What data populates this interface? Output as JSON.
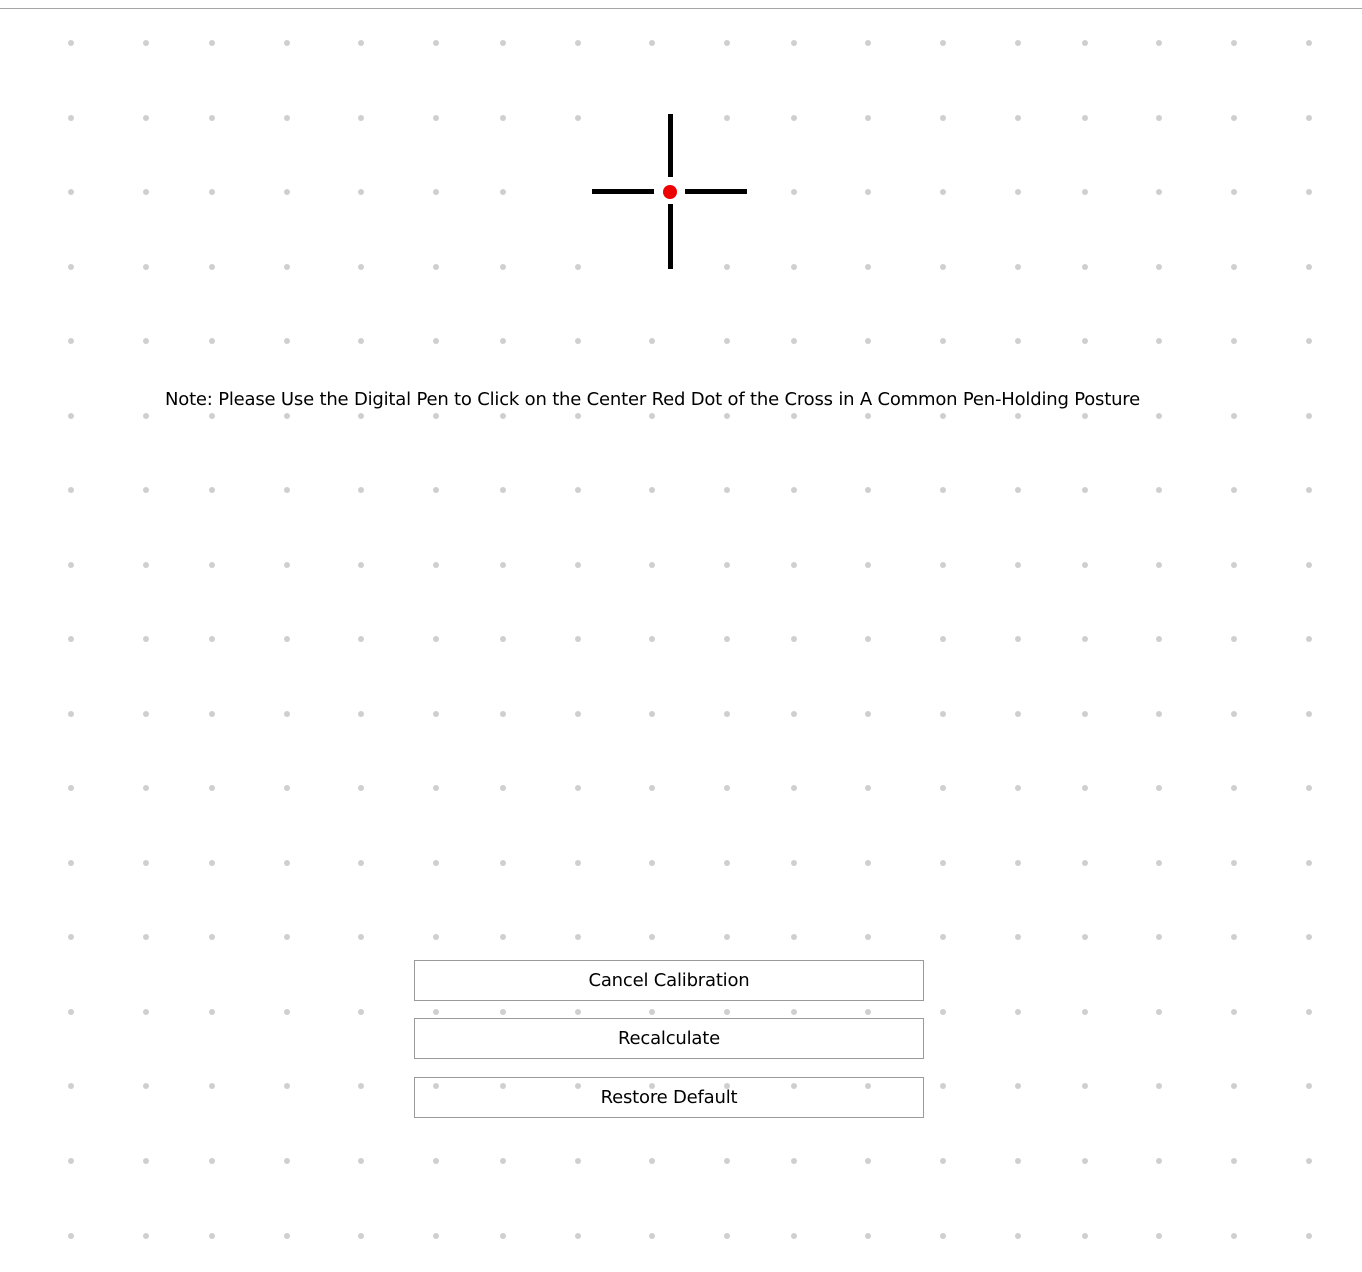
{
  "note": "Note: Please Use the Digital Pen to Click on the Center Red Dot of the Cross in A Common Pen-Holding Posture",
  "buttons": {
    "cancel": "Cancel Calibration",
    "recalculate": "Recalculate",
    "restore": "Restore Default"
  },
  "colors": {
    "target_dot": "#ee0000",
    "grid_dot": "#cfcfcf",
    "crosshair": "#000000"
  },
  "icons": {
    "calibration_target": "crosshair-icon"
  }
}
